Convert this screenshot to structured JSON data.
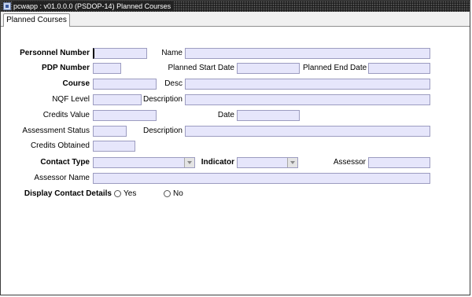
{
  "window": {
    "title": "pcwapp : v01.0.0.0 (PSDOP-14) Planned Courses"
  },
  "tabs": [
    {
      "label": "Planned Courses"
    }
  ],
  "form": {
    "personnel_number": {
      "label": "Personnel Number",
      "value": ""
    },
    "name": {
      "label": "Name",
      "value": ""
    },
    "pdp_number": {
      "label": "PDP Number",
      "value": ""
    },
    "planned_start_date": {
      "label": "Planned Start Date",
      "value": ""
    },
    "planned_end_date": {
      "label": "Planned End Date",
      "value": ""
    },
    "course": {
      "label": "Course",
      "value": ""
    },
    "course_desc": {
      "label": "Desc",
      "value": ""
    },
    "nqf_level": {
      "label": "NQF Level",
      "value": ""
    },
    "nqf_description": {
      "label": "Description",
      "value": ""
    },
    "credits_value": {
      "label": "Credits Value",
      "value": ""
    },
    "date": {
      "label": "Date",
      "value": ""
    },
    "assessment_status": {
      "label": "Assessment Status",
      "value": ""
    },
    "assessment_description": {
      "label": "Description",
      "value": ""
    },
    "credits_obtained": {
      "label": "Credits Obtained",
      "value": ""
    },
    "contact_type": {
      "label": "Contact Type",
      "value": ""
    },
    "indicator": {
      "label": "Indicator",
      "value": ""
    },
    "assessor": {
      "label": "Assessor",
      "value": ""
    },
    "assessor_name": {
      "label": "Assessor Name",
      "value": ""
    },
    "display_contact_details": {
      "label": "Display Contact Details",
      "options": [
        {
          "label": "Yes",
          "selected": false
        },
        {
          "label": "No",
          "selected": false
        }
      ]
    }
  }
}
